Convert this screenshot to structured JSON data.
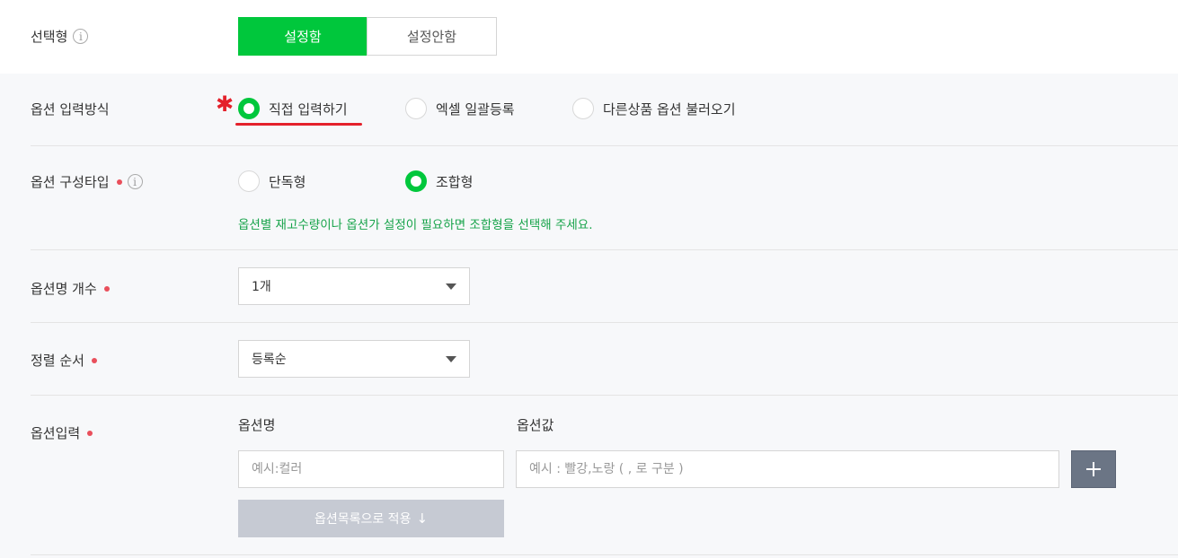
{
  "type_row": {
    "label": "선택형",
    "info_icon": "i",
    "options": [
      "설정함",
      "설정안함"
    ],
    "selected": "설정함"
  },
  "input_method": {
    "label": "옵션 입력방식",
    "options": [
      "직접 입력하기",
      "엑셀 일괄등록",
      "다른상품 옵션 불러오기"
    ],
    "selected": "직접 입력하기"
  },
  "config_type": {
    "label": "옵션 구성타입",
    "info_icon": "i",
    "options": [
      "단독형",
      "조합형"
    ],
    "selected": "조합형",
    "hint": "옵션별 재고수량이나 옵션가 설정이 필요하면 조합형을 선택해 주세요."
  },
  "name_count": {
    "label": "옵션명 개수",
    "value": "1개"
  },
  "sort_order": {
    "label": "정렬 순서",
    "value": "등록순"
  },
  "option_input": {
    "label": "옵션입력",
    "name_header": "옵션명",
    "value_header": "옵션값",
    "name_placeholder": "예시:컬러",
    "value_placeholder": "예시 : 빨강,노랑 ( , 로 구분 )",
    "apply_label": "옵션목록으로 적용",
    "apply_arrow": "↓",
    "add_icon": "plus-icon"
  },
  "annotation": {
    "star_glyph": "✱",
    "color": "#e4212b"
  },
  "colors": {
    "accent": "#00c73c",
    "required": "#e94f5b",
    "hint": "#17a34a"
  }
}
